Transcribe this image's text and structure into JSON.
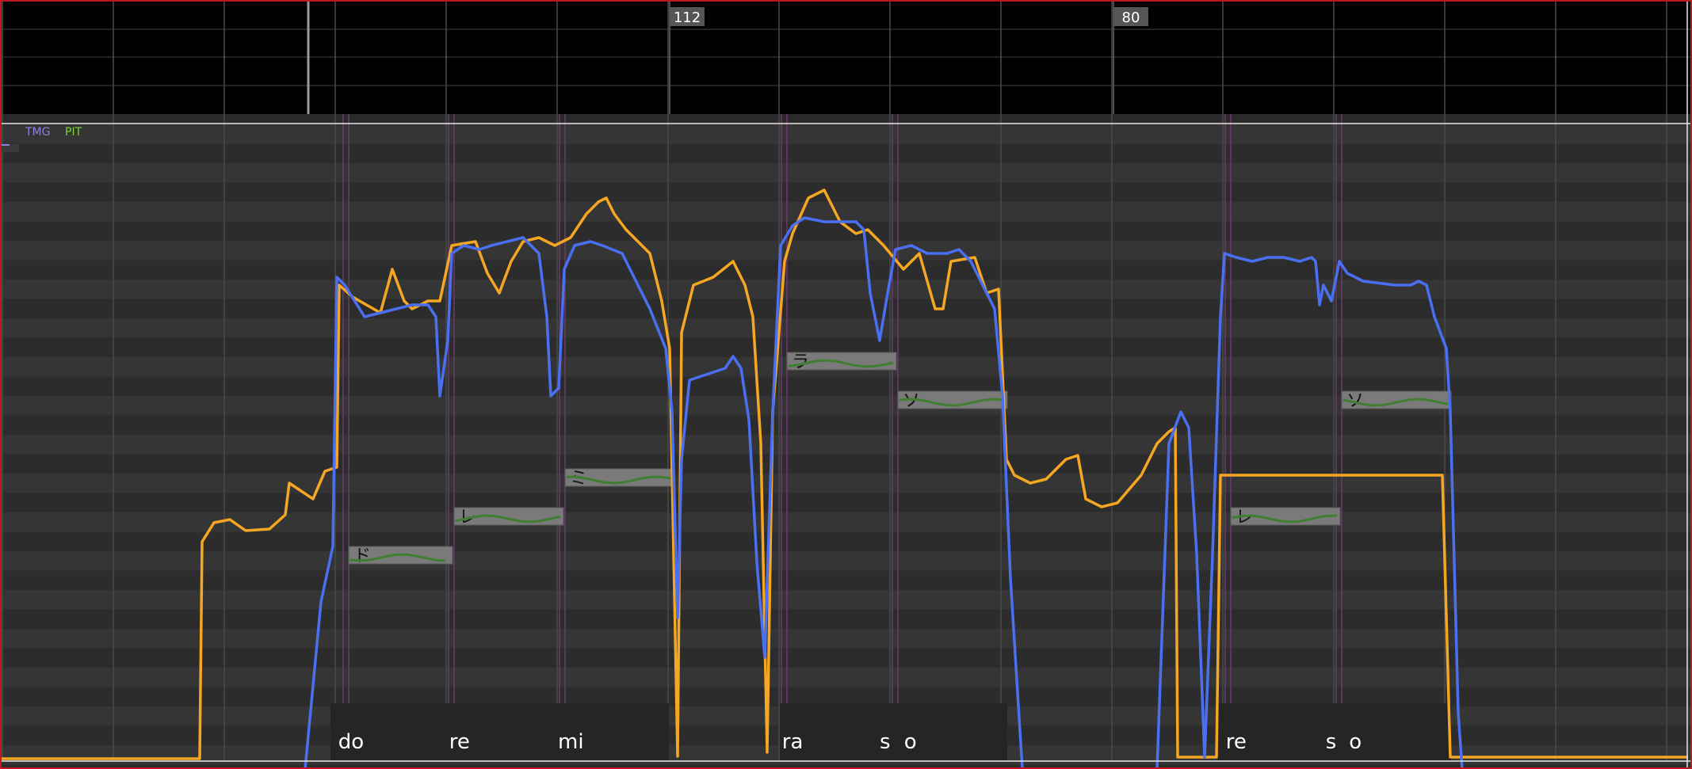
{
  "tempo_markers": [
    {
      "label": "112",
      "beat": 6
    },
    {
      "label": "80",
      "beat": 10
    }
  ],
  "param_tabs": [
    {
      "label": "TMG",
      "color": "#8f7fe0"
    },
    {
      "label": "PIT",
      "color": "#7fcf3a"
    }
  ],
  "notes": [
    {
      "lyric": "ド",
      "start": 3.05,
      "end": 4.0,
      "pitch": 2.0
    },
    {
      "lyric": "レ",
      "start": 4.0,
      "end": 5.0,
      "pitch": 3.0
    },
    {
      "lyric": "ミ",
      "start": 5.0,
      "end": 6.0,
      "pitch": 4.0
    },
    {
      "lyric": "ラ",
      "start": 7.0,
      "end": 8.0,
      "pitch": 7.0
    },
    {
      "lyric": "ソ",
      "start": 8.0,
      "end": 9.0,
      "pitch": 6.0
    },
    {
      "lyric": "レ",
      "start": 11.0,
      "end": 12.0,
      "pitch": 3.0
    },
    {
      "lyric": "ソ",
      "start": 12.0,
      "end": 13.0,
      "pitch": 6.0
    }
  ],
  "phonemes": [
    {
      "text": "do",
      "beat": 2.97
    },
    {
      "text": "re",
      "beat": 3.97
    },
    {
      "text": "mi",
      "beat": 4.95
    },
    {
      "text": "ra",
      "beat": 6.97
    },
    {
      "text": "s",
      "beat": 7.85
    },
    {
      "text": "o",
      "beat": 8.07
    },
    {
      "text": "re",
      "beat": 10.97
    },
    {
      "text": "s",
      "beat": 11.87
    },
    {
      "text": "o",
      "beat": 12.08
    }
  ],
  "colors": {
    "orange_curve": "#f5a623",
    "blue_curve": "#4a6ff0",
    "green_curve": "#3f7f2f",
    "note_fill": "#7a7a7a",
    "grid_row_dark": "#2c2c2c",
    "grid_row_light": "#353535",
    "timeline_bg": "#000000",
    "phoneme_line": "#6b3b6b"
  }
}
